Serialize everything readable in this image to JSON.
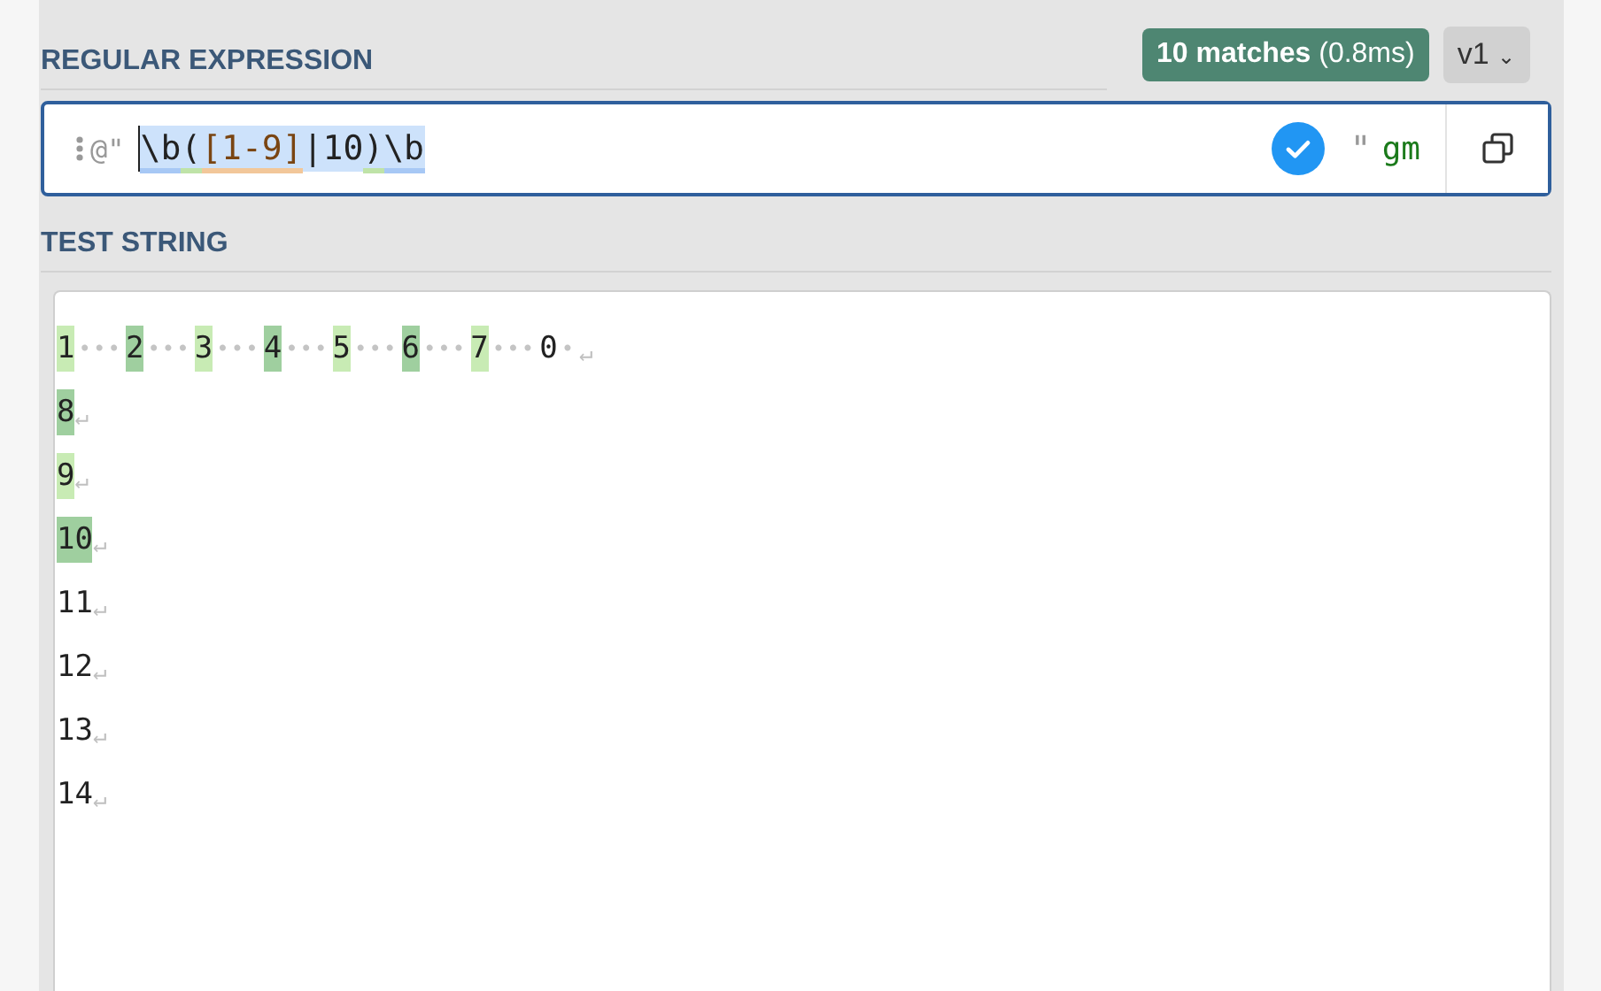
{
  "regex_section": {
    "title": "REGULAR EXPRESSION",
    "match_badge": {
      "count": "10 matches",
      "time": "(0.8ms)"
    },
    "version": {
      "label": "v1",
      "caret": "⌄"
    },
    "field": {
      "delimiter": "@\"",
      "selected": true,
      "tokens": [
        {
          "text": "\\b",
          "kind": "escape"
        },
        {
          "text": "(",
          "kind": "group"
        },
        {
          "text": "[1-9]",
          "kind": "class"
        },
        {
          "text": "|",
          "kind": "alternation"
        },
        {
          "text": "10",
          "kind": "literal"
        },
        {
          "text": ")",
          "kind": "group"
        },
        {
          "text": "\\b",
          "kind": "escape"
        }
      ],
      "valid": true,
      "closing_delimiter": "\"",
      "flags": "gm"
    }
  },
  "test_section": {
    "title": "TEST STRING",
    "lines": [
      {
        "tokens": [
          {
            "text": "1",
            "kind": "match",
            "color": "#c8ebb4"
          },
          {
            "text": "•••",
            "kind": "space"
          },
          {
            "text": "2",
            "kind": "match",
            "color": "#9fcf9f"
          },
          {
            "text": "•••",
            "kind": "space"
          },
          {
            "text": "3",
            "kind": "match",
            "color": "#c8ebb4"
          },
          {
            "text": "•••",
            "kind": "space"
          },
          {
            "text": "4",
            "kind": "match",
            "color": "#9fcf9f"
          },
          {
            "text": "•••",
            "kind": "space"
          },
          {
            "text": "5",
            "kind": "match",
            "color": "#c8ebb4"
          },
          {
            "text": "•••",
            "kind": "space"
          },
          {
            "text": "6",
            "kind": "match",
            "color": "#9fcf9f"
          },
          {
            "text": "•••",
            "kind": "space"
          },
          {
            "text": "7",
            "kind": "match",
            "color": "#c8ebb4"
          },
          {
            "text": "•••",
            "kind": "space"
          },
          {
            "text": "0",
            "kind": "text"
          },
          {
            "text": "•",
            "kind": "space"
          }
        ],
        "eol": "↵"
      },
      {
        "tokens": [
          {
            "text": "8",
            "kind": "match",
            "color": "#9fcf9f"
          }
        ],
        "eol": "↵"
      },
      {
        "tokens": [
          {
            "text": "9",
            "kind": "match",
            "color": "#c8ebb4"
          }
        ],
        "eol": "↵"
      },
      {
        "tokens": [
          {
            "text": "10",
            "kind": "match",
            "color": "#9fcf9f"
          }
        ],
        "eol": "↵"
      },
      {
        "tokens": [
          {
            "text": "11",
            "kind": "text"
          }
        ],
        "eol": "↵"
      },
      {
        "tokens": [
          {
            "text": "12",
            "kind": "text"
          }
        ],
        "eol": "↵"
      },
      {
        "tokens": [
          {
            "text": "13",
            "kind": "text"
          }
        ],
        "eol": "↵"
      },
      {
        "tokens": [
          {
            "text": "14",
            "kind": "text"
          }
        ],
        "eol": "↵"
      }
    ]
  }
}
